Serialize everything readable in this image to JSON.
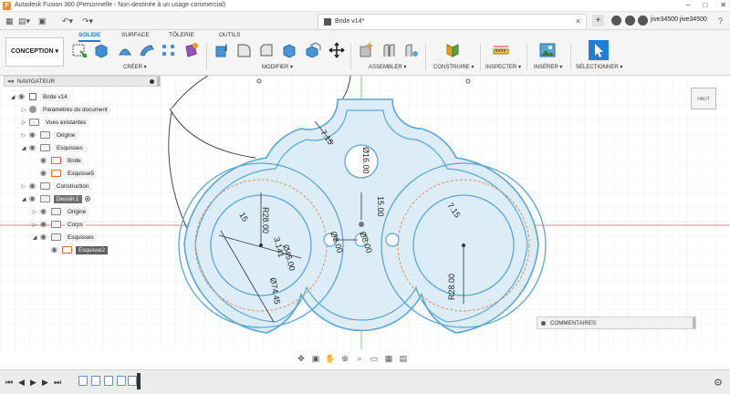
{
  "window": {
    "title": "Autodesk Fusion 360 (Personnelle - Non destinée à un usage commercial)",
    "logo": "F"
  },
  "document": {
    "tab_title": "Bride v14*",
    "user": "jive34500 jive34500"
  },
  "ribbon": {
    "workspace": "CONCEPTION ▾",
    "tabs": [
      "SOLIDE",
      "SURFACE",
      "TÔLERIE",
      "OUTILS"
    ],
    "active_tab": "SOLIDE",
    "groups": [
      "CRÉER ▾",
      "MODIFIER ▾",
      "ASSEMBLER ▾",
      "CONSTRUIRE ▾",
      "INSPECTER ▾",
      "INSÉRER ▾",
      "SÉLECTIONNER ▾"
    ]
  },
  "browser": {
    "title": "NAVIGATEUR",
    "nodes": [
      {
        "label": "Bride v14"
      },
      {
        "label": "Paramètres du document"
      },
      {
        "label": "Vues existantes"
      },
      {
        "label": "Origine"
      },
      {
        "label": "Esquisses"
      },
      {
        "label": "Bride"
      },
      {
        "label": "Esquisse5"
      },
      {
        "label": "Construction"
      },
      {
        "label": "Dessin:1"
      },
      {
        "label": "Origine"
      },
      {
        "label": "Corps"
      },
      {
        "label": "Esquisses"
      },
      {
        "label": "Esquisse2"
      }
    ]
  },
  "viewcube": {
    "label": "HAUT"
  },
  "comments": {
    "title": "COMMENTAIRES"
  },
  "dimensions": {
    "d1": "7.15",
    "d2": "Ø16.00",
    "d3": "15.00",
    "d4": "R28.00",
    "d5": "15",
    "d6": "3.141",
    "d7": "Ø45.00",
    "d8": "Ø8.00",
    "d9": "Ø8.00",
    "d10": "Ø74.45",
    "d11": "7.15",
    "d12": "R28.00"
  },
  "colors": {
    "accent": "#1f7fd5",
    "sketch_blue": "#5aa7d4",
    "profile_fill": "#dcedf8",
    "construction": "#d88a4d",
    "axis_red": "#e05050",
    "axis_green": "#5fbf5f"
  }
}
